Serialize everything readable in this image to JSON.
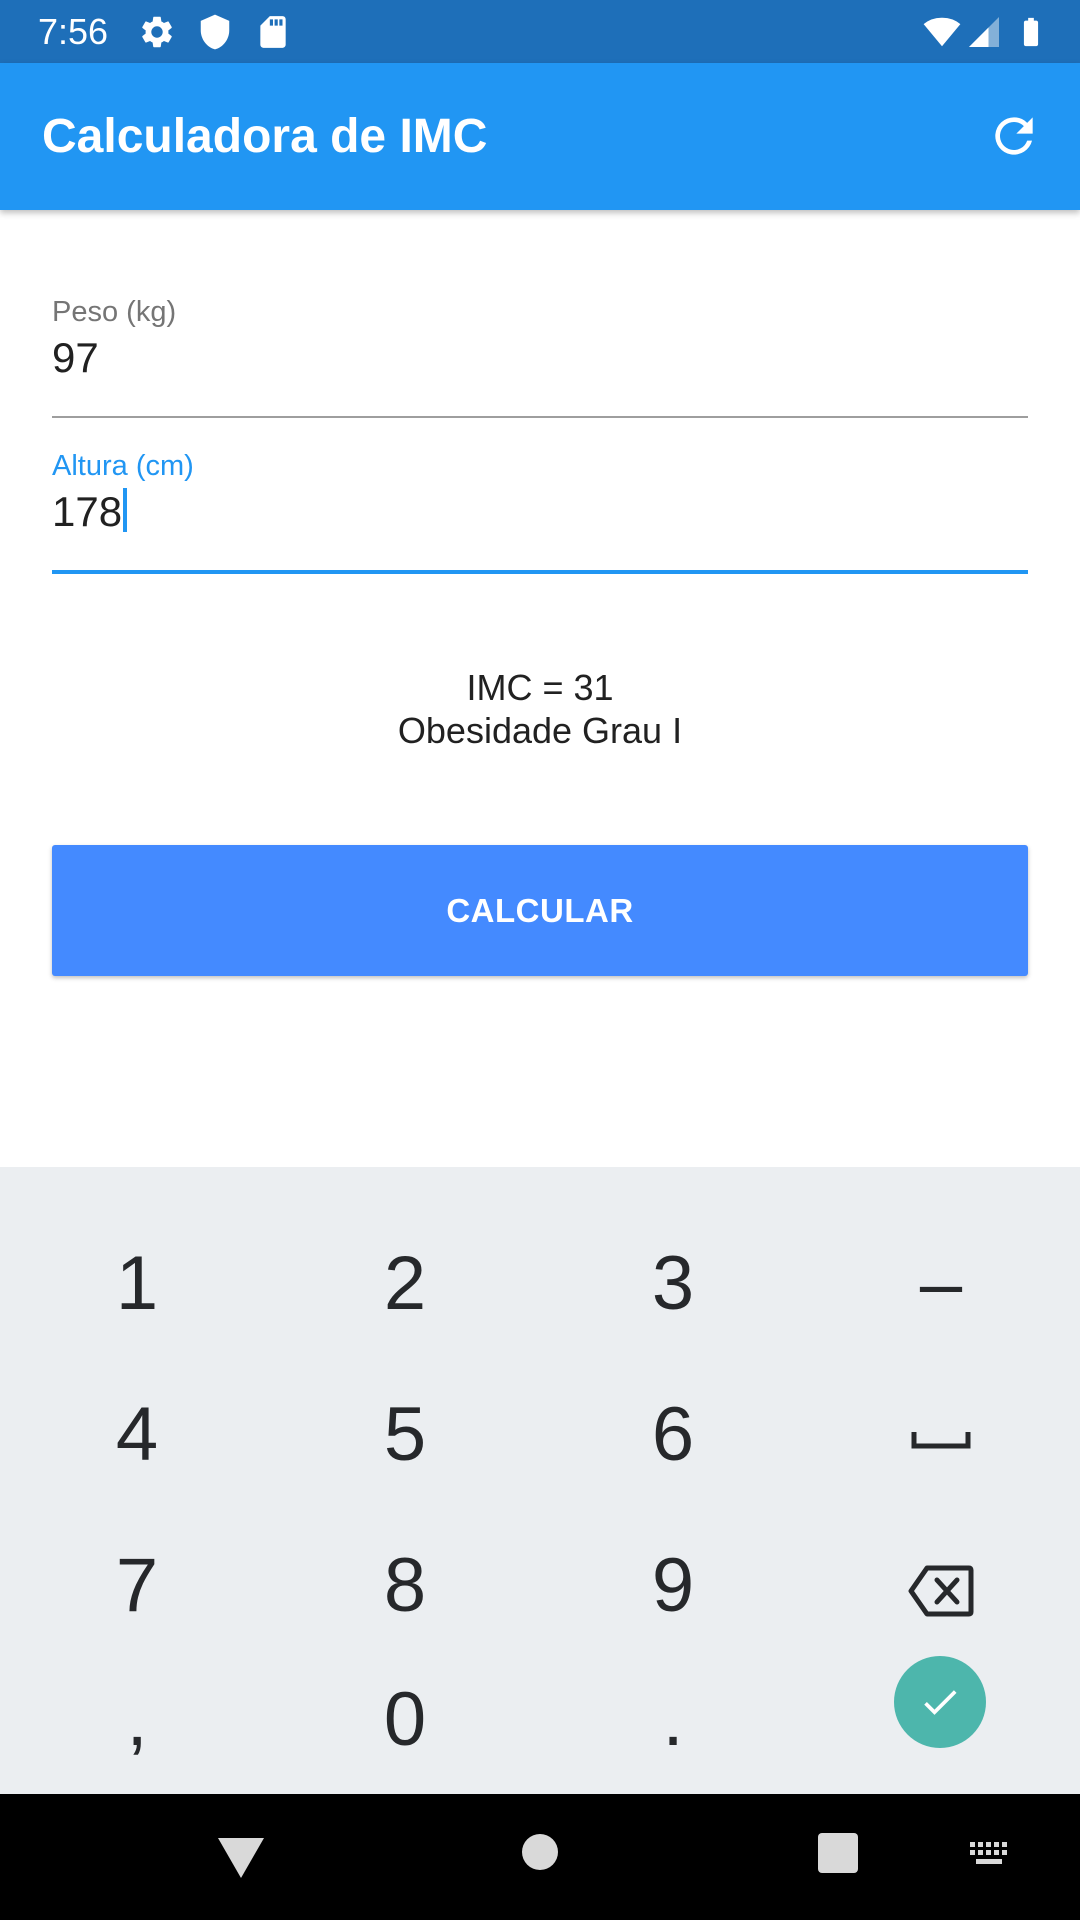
{
  "status_bar": {
    "time": "7:56",
    "icons": [
      "settings-icon",
      "shield-icon",
      "sd-card-icon",
      "wifi-icon",
      "signal-icon",
      "battery-icon"
    ]
  },
  "app_bar": {
    "title": "Calculadora de IMC",
    "action_icon": "refresh-icon"
  },
  "form": {
    "weight": {
      "label": "Peso (kg)",
      "value": "97"
    },
    "height": {
      "label": "Altura (cm)",
      "value": "178"
    }
  },
  "result": {
    "imc": "IMC = 31",
    "category": "Obesidade Grau I"
  },
  "button": {
    "label": "CALCULAR"
  },
  "keyboard": {
    "keys": [
      "1",
      "2",
      "3",
      "–",
      "4",
      "5",
      "6",
      "7",
      "8",
      "9",
      ",",
      "0",
      "."
    ],
    "icons": [
      "space-key-icon",
      "backspace-icon",
      "done-check-icon"
    ]
  },
  "nav_bar": {
    "icons": [
      "back-icon",
      "home-icon",
      "recents-icon",
      "keyboard-icon"
    ]
  },
  "colors": {
    "status_bar": "#1e6fb9",
    "app_bar": "#2196f3",
    "accent": "#2196f3",
    "button": "#448aff",
    "keyboard_bg": "#ebeef1",
    "done_key": "#4db6ac"
  }
}
